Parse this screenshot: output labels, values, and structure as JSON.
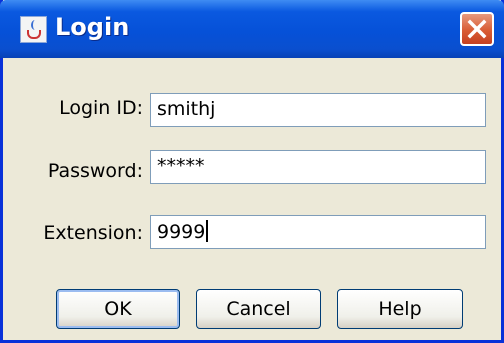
{
  "window": {
    "title": "Login",
    "title_icon": "java-cup-icon",
    "close_icon": "close-icon"
  },
  "form": {
    "login_id": {
      "label": "Login ID:",
      "value": "smithj"
    },
    "password": {
      "label": "Password:",
      "value": "*****"
    },
    "extension": {
      "label": "Extension:",
      "value": "9999"
    }
  },
  "buttons": {
    "ok": "OK",
    "cancel": "Cancel",
    "help": "Help"
  },
  "colors": {
    "titlebar": "#0a59e0",
    "window_bg": "#ece9d8",
    "close_button": "#d95c34",
    "frame": "#0831d9"
  }
}
